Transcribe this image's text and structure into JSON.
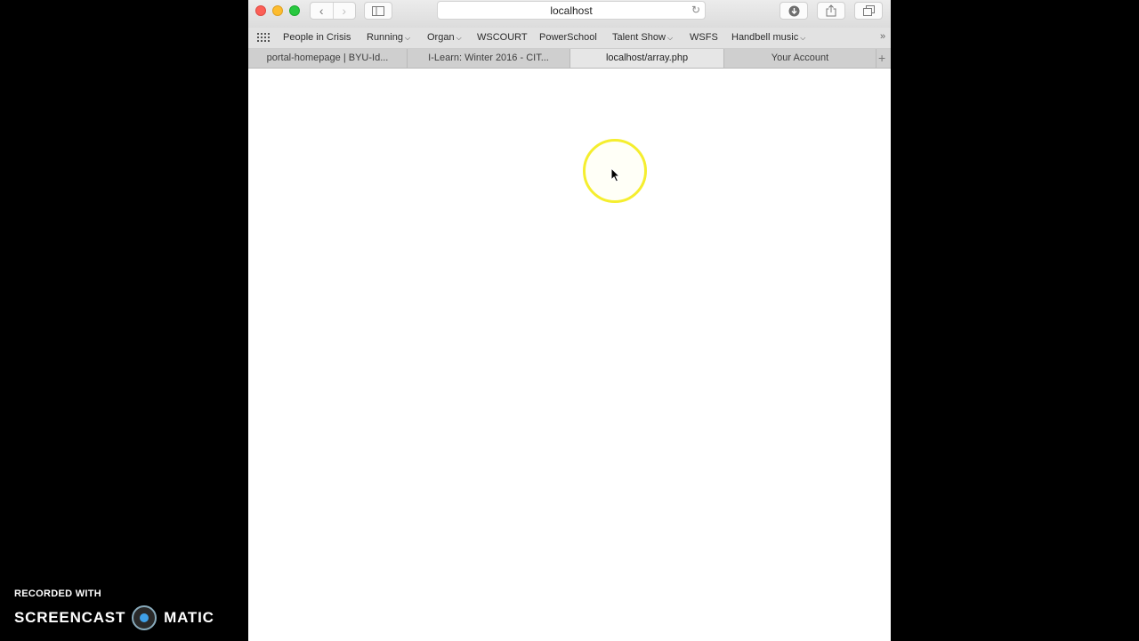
{
  "address_bar": {
    "url": "localhost"
  },
  "bookmarks": [
    {
      "label": "People in Crisis",
      "dropdown": false
    },
    {
      "label": "Running",
      "dropdown": true
    },
    {
      "label": "Organ",
      "dropdown": true
    },
    {
      "label": "WSCOURT",
      "dropdown": false
    },
    {
      "label": "PowerSchool",
      "dropdown": false
    },
    {
      "label": "Talent Show",
      "dropdown": true
    },
    {
      "label": "WSFS",
      "dropdown": false
    },
    {
      "label": "Handbell music",
      "dropdown": true
    }
  ],
  "tabs": [
    {
      "label": "portal-homepage | BYU-Id...",
      "active": false
    },
    {
      "label": "I-Learn: Winter 2016 - CIT...",
      "active": false
    },
    {
      "label": "localhost/array.php",
      "active": true
    },
    {
      "label": "Your Account",
      "active": false
    }
  ],
  "watermark": {
    "line1": "RECORDED WITH",
    "brand_left": "SCREENCAST",
    "brand_right": "MATIC"
  },
  "colors": {
    "highlight_ring": "#f5ee2e",
    "close": "#fc5f57",
    "minimize": "#fdbc2e",
    "zoom": "#28c840",
    "logo_accent": "#3fa0e8"
  }
}
